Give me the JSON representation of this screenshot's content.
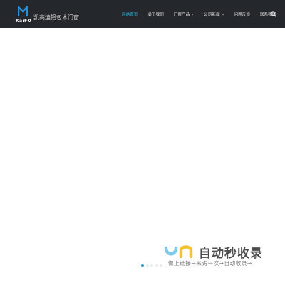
{
  "header": {
    "logo_text": "KaiFO",
    "brand_name": "凯高迪铝包木门窗"
  },
  "nav": {
    "items": [
      {
        "label": "网站首页"
      },
      {
        "label": "关于我们"
      },
      {
        "label": "门窗产品"
      },
      {
        "label": "公司新闻"
      },
      {
        "label": "问题反馈"
      },
      {
        "label": "联系我们"
      }
    ]
  },
  "slider": {
    "dot_count": 5,
    "active_index": 0
  },
  "watermark": {
    "title": "自动秒收录",
    "subtitle": "做上链接→来访一次→自动收录→"
  },
  "colors": {
    "header_bg": "#24272c",
    "accent": "#33b7d9",
    "dot_active": "#2d9bd1",
    "logo_blue": "#2a8fd6"
  }
}
